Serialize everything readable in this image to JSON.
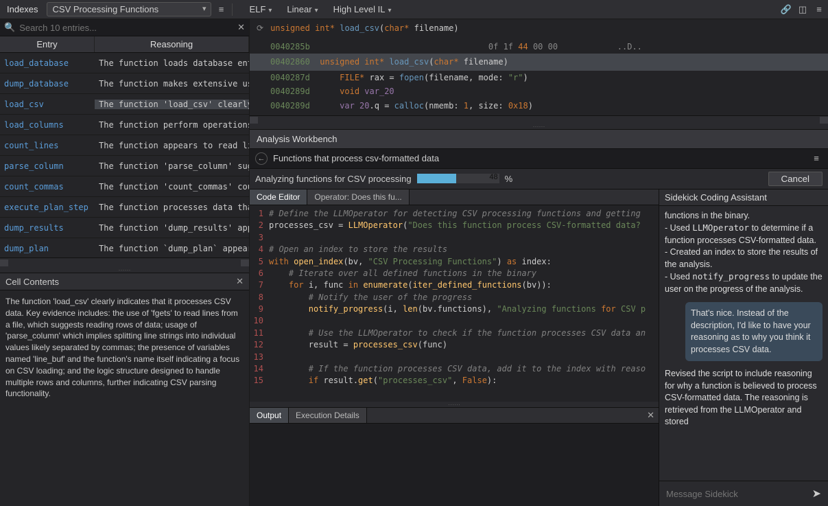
{
  "topbar": {
    "indexes_label": "Indexes",
    "dropdown_value": "CSV Processing Functions",
    "menus": [
      "ELF",
      "Linear",
      "High Level IL"
    ]
  },
  "search": {
    "placeholder": "Search 10 entries..."
  },
  "table": {
    "headers": {
      "entry": "Entry",
      "reasoning": "Reasoning"
    },
    "rows": [
      {
        "entry": "load_database",
        "reason": "The function loads database entries"
      },
      {
        "entry": "dump_database",
        "reason": "The function makes extensive use"
      },
      {
        "entry": "load_csv",
        "reason": "The function 'load_csv' clearly",
        "selected": true
      },
      {
        "entry": "load_columns",
        "reason": "The function perform operations"
      },
      {
        "entry": "count_lines",
        "reason": "The function appears to read li"
      },
      {
        "entry": "parse_column",
        "reason": "The function 'parse_column' sug"
      },
      {
        "entry": "count_commas",
        "reason": "The function 'count_commas' cou"
      },
      {
        "entry": "execute_plan_step",
        "reason": "The function processes data tha"
      },
      {
        "entry": "dump_results",
        "reason": "The function 'dump_results' app"
      },
      {
        "entry": "dump_plan",
        "reason": "The function `dump_plan` appears"
      }
    ]
  },
  "cell": {
    "title": "Cell Contents",
    "body": "The function 'load_csv' clearly indicates that it processes CSV data. Key evidence includes: the use of 'fgets' to read lines from a file, which suggests reading rows of data; usage of 'parse_column' which implies splitting line strings into individual values likely separated by commas; the presence of variables named 'line_buf' and the function's name itself indicating a focus on CSV loading; and the logic structure designed to handle multiple rows and columns, further indicating CSV parsing functionality."
  },
  "signature": {
    "ret_type": "unsigned int*",
    "name": "load_csv",
    "param_type": "char*",
    "param_name": "filename"
  },
  "disasm": {
    "rows": [
      {
        "addr": "0040285b",
        "hex": "0f 1f 44 00 00",
        "ascii": "..D.."
      },
      {
        "addr": "00402860",
        "sig": true
      },
      {
        "addr": "0040287d",
        "code": "FILE* rax = fopen(filename, mode: \"r\")"
      },
      {
        "addr": "0040289d",
        "code": "void var_20"
      },
      {
        "addr": "0040289d",
        "code": "var 20.q = calloc(nmemb: 1, size: 0x18)"
      }
    ]
  },
  "workbench": {
    "title": "Analysis Workbench",
    "crumb": "Functions that process csv-formatted data",
    "progress_label": "Analyzing functions for CSV processing",
    "progress_pct": "48",
    "pct_suffix": "%",
    "cancel": "Cancel",
    "tabs": {
      "editor": "Code Editor",
      "operator": "Operator: Does this fu..."
    }
  },
  "editor": {
    "lines": [
      "# Define the LLMOperator for detecting CSV processing functions and getting ",
      "processes_csv = LLMOperator(\"Does this function process CSV-formatted data?",
      "",
      "# Open an index to store the results",
      "with open_index(bv, \"CSV Processing Functions\") as index:",
      "    # Iterate over all defined functions in the binary",
      "    for i, func in enumerate(iter_defined_functions(bv)):",
      "        # Notify the user of the progress",
      "        notify_progress(i, len(bv.functions), \"Analyzing functions for CSV p",
      "",
      "        # Use the LLMOperator to check if the function processes CSV data an",
      "        result = processes_csv(func)",
      "",
      "        # If the function processes CSV data, add it to the index with reaso",
      "        if result.get(\"processes_csv\", False):"
    ]
  },
  "output": {
    "tabs": {
      "output": "Output",
      "exec": "Execution Details"
    }
  },
  "sidekick": {
    "title": "Sidekick Coding Assistant",
    "msg1": "functions in the binary.\n- Used `LLMOperator` to determine if a function processes CSV-formatted data.\n- Created an index to store the results of the analysis.\n- Used `notify_progress` to update the user on the progress of the analysis.",
    "user_msg": "That's nice. Instead of the description, I'd like to have your reasoning as to why you think it processes CSV data.",
    "msg2": "Revised the script to include reasoning for why a function is believed to process CSV-formatted data. The reasoning is retrieved from the LLMOperator and stored",
    "placeholder": "Message Sidekick"
  }
}
